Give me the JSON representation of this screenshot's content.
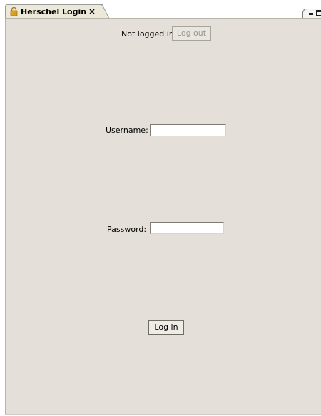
{
  "tab": {
    "title": "Herschel Login",
    "close_symbol": "×",
    "icon": "lock-icon"
  },
  "view_controls": {
    "minimize_icon": "minimize-icon",
    "maximize_icon": "maximize-icon"
  },
  "status": {
    "text": "Not logged in",
    "logout_label": "Log out"
  },
  "form": {
    "username_label": "Username:",
    "username_value": "",
    "password_label": "Password:",
    "password_value": "",
    "login_label": "Log in"
  },
  "colors": {
    "panel_bg": "#e4e0d9",
    "tab_bg": "#ece9d8",
    "lock_icon": "#e0a21b"
  }
}
